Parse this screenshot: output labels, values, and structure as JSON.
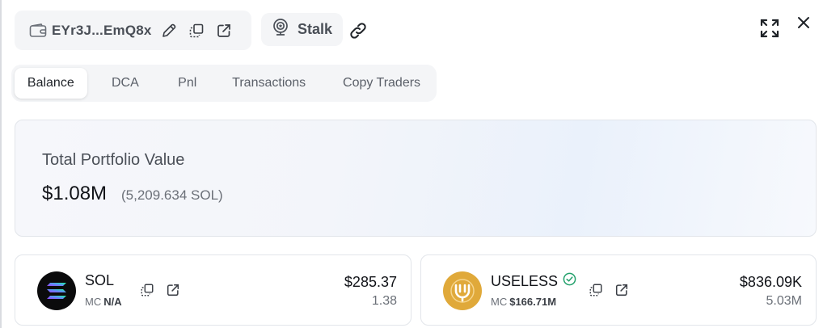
{
  "header": {
    "wallet_address": "EYr3J...EmQ8x",
    "stalk_label": "Stalk"
  },
  "tabs": [
    {
      "label": "Balance",
      "active": true
    },
    {
      "label": "DCA",
      "active": false
    },
    {
      "label": "Pnl",
      "active": false
    },
    {
      "label": "Transactions",
      "active": false
    },
    {
      "label": "Copy Traders",
      "active": false
    }
  ],
  "portfolio": {
    "label": "Total Portfolio Value",
    "value": "$1.08M",
    "sol_value": "(5,209.634 SOL)"
  },
  "tokens": [
    {
      "symbol": "SOL",
      "mc_label": "MC",
      "mc_value": "N/A",
      "usd_value": "$285.37",
      "amount": "1.38",
      "verified": false
    },
    {
      "symbol": "USELESS",
      "mc_label": "MC",
      "mc_value": "$166.71M",
      "usd_value": "$836.09K",
      "amount": "5.03M",
      "verified": true
    }
  ],
  "icons": {
    "wallet": "wallet-icon",
    "edit": "pencil-icon",
    "copy": "copy-icon",
    "external": "external-link-icon",
    "stalk": "stalk-icon",
    "link": "link-icon",
    "expand": "expand-icon",
    "close": "close-icon",
    "verified": "verified-check-icon"
  },
  "colors": {
    "chip_bg": "#f4f5f7",
    "text_primary": "#111318",
    "text_muted": "#6b7078",
    "verified_green": "#22a06b",
    "useless_gold": "#e0a93a"
  }
}
